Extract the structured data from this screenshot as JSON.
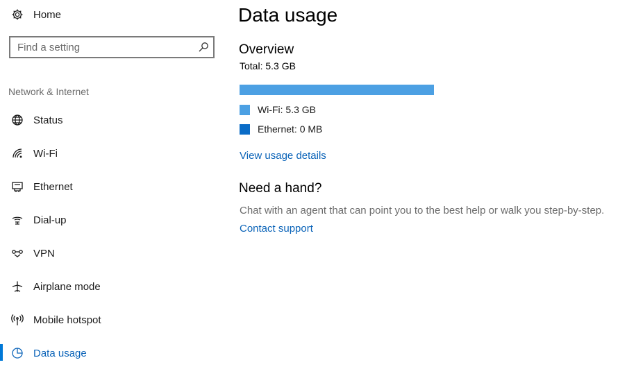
{
  "sidebar": {
    "home_label": "Home",
    "search": {
      "placeholder": "Find a setting",
      "value": ""
    },
    "section_label": "Network & Internet",
    "items": [
      {
        "label": "Status",
        "icon": "globe-icon"
      },
      {
        "label": "Wi-Fi",
        "icon": "wifi-icon"
      },
      {
        "label": "Ethernet",
        "icon": "ethernet-icon"
      },
      {
        "label": "Dial-up",
        "icon": "dialup-icon"
      },
      {
        "label": "VPN",
        "icon": "vpn-icon"
      },
      {
        "label": "Airplane mode",
        "icon": "airplane-icon"
      },
      {
        "label": "Mobile hotspot",
        "icon": "hotspot-icon"
      },
      {
        "label": "Data usage",
        "icon": "pie-chart-icon",
        "active": true
      }
    ]
  },
  "main": {
    "title": "Data usage",
    "overview": {
      "heading": "Overview",
      "total": "Total: 5.3 GB",
      "usage_fraction_wifi": 1.0,
      "legend": [
        {
          "label": "Wi-Fi: 5.3 GB",
          "color": "#4ca0e3"
        },
        {
          "label": "Ethernet: 0 MB",
          "color": "#0a6cc7"
        }
      ],
      "link": "View usage details"
    },
    "help": {
      "heading": "Need a hand?",
      "text": "Chat with an agent that can point you to the best help or walk you step-by-step.",
      "link": "Contact support"
    }
  },
  "colors": {
    "accent": "#0078d7",
    "link": "#0a63b8",
    "wifi_bar": "#4ca0e3",
    "ethernet_swatch": "#0a6cc7"
  }
}
